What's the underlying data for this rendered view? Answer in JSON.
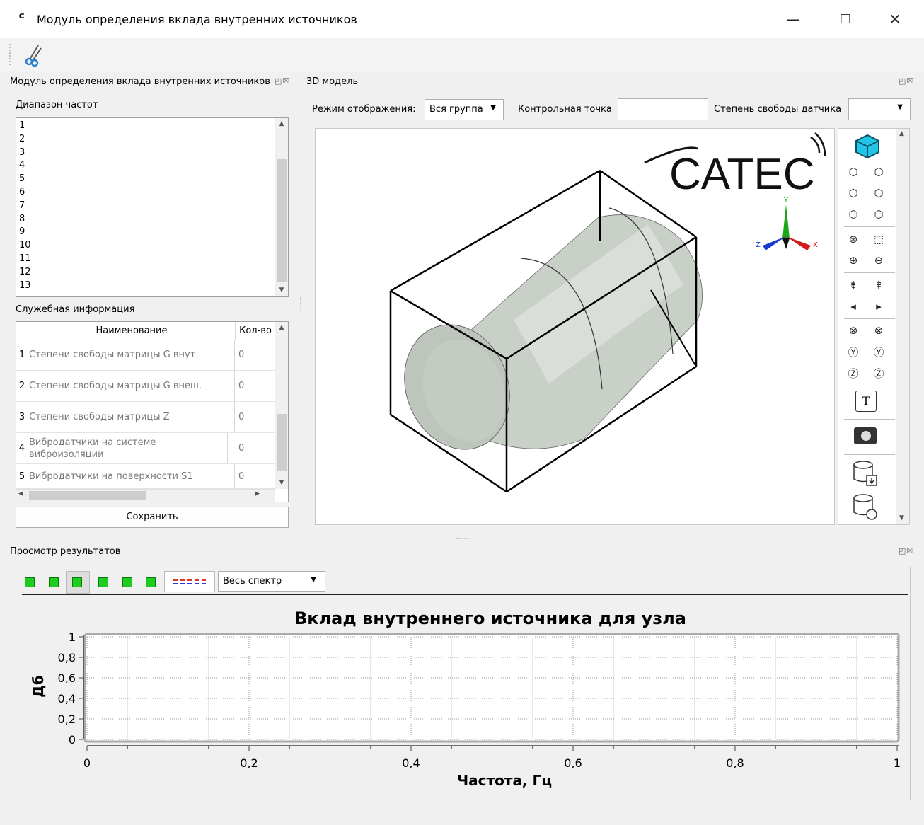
{
  "window": {
    "title": "Модуль определения вклада внутренних источников",
    "minimize": "—",
    "maximize": "☐",
    "close": "✕"
  },
  "left_panel": {
    "title": "Модуль определения вклада внутренних источников",
    "freq_label": "Диапазон частот",
    "freq_items": [
      "1",
      "2",
      "3",
      "4",
      "5",
      "6",
      "7",
      "8",
      "9",
      "10",
      "11",
      "12",
      "13"
    ],
    "service_label": "Служебная информация",
    "table": {
      "headers": [
        "Наименование",
        "Кол-во"
      ],
      "rows": [
        {
          "n": "1",
          "name": "Степени свободы матрицы G внут.",
          "value": "0"
        },
        {
          "n": "2",
          "name": "Степени свободы матрицы G внеш.",
          "value": "0"
        },
        {
          "n": "3",
          "name": "Степени свободы матрицы Z",
          "value": "0"
        },
        {
          "n": "4",
          "name": "Вибродатчики на системе виброизоляции",
          "value": "0"
        },
        {
          "n": "5",
          "name": "Вибродатчики на поверхности S1",
          "value": "0"
        }
      ]
    },
    "save_button": "Сохранить"
  },
  "model_panel": {
    "title": "3D модель",
    "display_mode_label": "Режим отображения:",
    "display_mode_value": "Вся группа",
    "control_point_label": "Контрольная точка",
    "control_point_value": "",
    "dof_label": "Степень свободы датчика",
    "dof_value": "",
    "logo": "CATEC",
    "axes": {
      "x": "X",
      "y": "Y",
      "z": "Z"
    }
  },
  "results_panel": {
    "title": "Просмотр результатов",
    "spectrum_select": "Весь спектр",
    "chart_title": "Вклад внутреннего источника для узла",
    "xlabel": "Частота, Гц",
    "ylabel": "Дб",
    "xticks": [
      "0",
      "0,2",
      "0,4",
      "0,6",
      "0,8",
      "1"
    ],
    "yticks": [
      "1",
      "0,8",
      "0,6",
      "0,4",
      "0,2",
      "0"
    ]
  },
  "chart_data": {
    "type": "line",
    "title": "Вклад внутреннего источника для узла",
    "xlabel": "Частота, Гц",
    "ylabel": "Дб",
    "xlim": [
      0,
      1
    ],
    "ylim": [
      0,
      1
    ],
    "series": [],
    "grid": true
  }
}
